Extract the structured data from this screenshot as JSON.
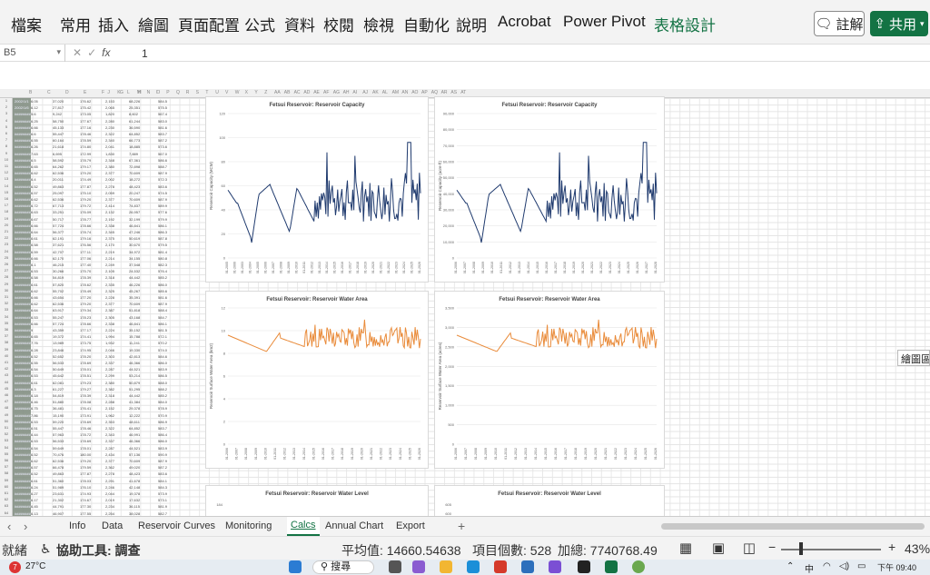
{
  "ribbon": {
    "menu": [
      "檔案",
      "常用",
      "插入",
      "繪圖",
      "頁面配置",
      "公式",
      "資料",
      "校閱",
      "檢視",
      "自動化",
      "說明",
      "Acrobat",
      "Power Pivot",
      "表格設計"
    ],
    "comment_label": "註解",
    "share_label": "共用"
  },
  "formula_bar": {
    "cell_ref": "B5",
    "value": "1"
  },
  "columns": [
    "B",
    "C",
    "D",
    "E",
    "F",
    "G",
    "H",
    "I",
    "J",
    "K",
    "L",
    "M",
    "N",
    "O",
    "P",
    "Q",
    "R",
    "S",
    "T",
    "U",
    "V",
    "W",
    "X",
    "Y",
    "Z",
    "AA",
    "AB",
    "AC",
    "AD",
    "AE",
    "AF",
    "AG",
    "AH",
    "AI",
    "AJ",
    "AK",
    "AL",
    "AM",
    "AN",
    "AO",
    "AP",
    "AQ",
    "AR",
    "AS",
    "AT"
  ],
  "rows_visible": 64,
  "data_rows": [
    [
      "2002/1/1",
      "6.05",
      "37,020",
      "176.62",
      "2,153",
      "68,226",
      "584.5"
    ],
    [
      "2002/1/6",
      "6.12",
      "27,817",
      "175.42",
      "2,065",
      "25,351",
      "575.5"
    ],
    [
      "########",
      "5.6",
      "9,242",
      "173.05",
      "1,820",
      "8,602",
      "567.4"
    ],
    [
      "########",
      "6.25",
      "58,750",
      "177.67",
      "2,280",
      "61,244",
      "583.0"
    ],
    [
      "########",
      "6.66",
      "45,133",
      "177.16",
      "2,230",
      "36,590",
      "581.6"
    ],
    [
      "########",
      "6.6",
      "55,447",
      "178.46",
      "2,322",
      "64,852",
      "583.7"
    ],
    [
      "########",
      "6.55",
      "60,164",
      "178.59",
      "2,340",
      "66,773",
      "587.2"
    ],
    [
      "########",
      "6.26",
      "21,618",
      "174.80",
      "2,041",
      "18,885",
      "573.6"
    ],
    [
      "########",
      "7.63",
      "6,695",
      "172.99",
      "1,830",
      "7,889",
      "567.0"
    ],
    [
      "########",
      "6.5",
      "58,592",
      "178.79",
      "2,348",
      "67,361",
      "586.6"
    ],
    [
      "########",
      "6.65",
      "64,262",
      "179.17",
      "2,380",
      "72,898",
      "588.7"
    ],
    [
      "########",
      "6.62",
      "62,536",
      "179.20",
      "2,377",
      "70,609",
      "587.9"
    ],
    [
      "########",
      "6.4",
      "20,011",
      "174.49",
      "2,002",
      "18,272",
      "572.3"
    ],
    [
      "########",
      "6.52",
      "49,863",
      "177.87",
      "2,278",
      "48,423",
      "583.6"
    ],
    [
      "########",
      "6.57",
      "25,097",
      "175.10",
      "2,059",
      "20,247",
      "574.5"
    ],
    [
      "########",
      "6.62",
      "62,536",
      "179.20",
      "2,377",
      "70,609",
      "587.9"
    ],
    [
      "########",
      "6.72",
      "67,713",
      "179.72",
      "2,414",
      "74,837",
      "589.9"
    ],
    [
      "########",
      "6.63",
      "33,251",
      "176.09",
      "2,132",
      "26,957",
      "577.6"
    ],
    [
      "########",
      "6.67",
      "50,717",
      "178.77",
      "2,192",
      "32,199",
      "579.9"
    ],
    [
      "########",
      "6.66",
      "57,724",
      "178.66",
      "2,338",
      "46,841",
      "586.1"
    ],
    [
      "########",
      "6.64",
      "56,377",
      "178.74",
      "2,345",
      "47,246",
      "586.3"
    ],
    [
      "########",
      "6.61",
      "62,191",
      "179.16",
      "2,375",
      "50,619",
      "587.8"
    ],
    [
      "########",
      "6.58",
      "37,621",
      "176.56",
      "2,170",
      "30,670",
      "579.5"
    ],
    [
      "########",
      "6.59",
      "42,707",
      "177.11",
      "2,219",
      "34,972",
      "581.4"
    ],
    [
      "########",
      "6.66",
      "62,170",
      "177.06",
      "2,214",
      "34,155",
      "580.8"
    ],
    [
      "########",
      "6.1",
      "46,215",
      "177.40",
      "2,249",
      "37,548",
      "582.3"
    ],
    [
      "########",
      "6.53",
      "30,266",
      "175.70",
      "2,105",
      "24,532",
      "576.4"
    ],
    [
      "########",
      "6.58",
      "54,819",
      "178.39",
      "2,318",
      "44,442",
      "585.2"
    ],
    [
      "########",
      "6.61",
      "57,820",
      "178.62",
      "2,335",
      "46,226",
      "586.0"
    ],
    [
      "########",
      "6.62",
      "55,702",
      "178.49",
      "2,325",
      "45,267",
      "585.6"
    ],
    [
      "########",
      "6.66",
      "43,654",
      "177.20",
      "2,228",
      "35,391",
      "581.6"
    ],
    [
      "########",
      "6.62",
      "62,536",
      "179.20",
      "2,377",
      "70,609",
      "587.9"
    ],
    [
      "########",
      "6.64",
      "63,917",
      "179.34",
      "2,387",
      "51,818",
      "588.4"
    ],
    [
      "########",
      "6.53",
      "55,247",
      "178.23",
      "2,305",
      "43,168",
      "584.7"
    ],
    [
      "########",
      "6.66",
      "57,724",
      "178.66",
      "2,338",
      "46,841",
      "586.1"
    ],
    [
      "########",
      "9",
      "43,359",
      "177.17",
      "2,224",
      "35,152",
      "581.5"
    ],
    [
      "########",
      "6.65",
      "19,372",
      "174.41",
      "1,994",
      "15,788",
      "572.1"
    ],
    [
      "########",
      "7.76",
      "13,989",
      "173.75",
      "1,932",
      "11,241",
      "570.2"
    ],
    [
      "########",
      "6.28",
      "23,846",
      "174.95",
      "2,046",
      "19,330",
      "574.0"
    ],
    [
      "########",
      "6.52",
      "52,652",
      "178.20",
      "2,303",
      "42,813",
      "584.6"
    ],
    [
      "########",
      "6.55",
      "56,533",
      "178.69",
      "2,337",
      "46,366",
      "586.0"
    ],
    [
      "########",
      "6.54",
      "50,649",
      "178.01",
      "2,287",
      "44,521",
      "583.9"
    ],
    [
      "########",
      "6.53",
      "45,642",
      "178.51",
      "2,299",
      "53,214",
      "586.5"
    ],
    [
      "########",
      "6.61",
      "62,081",
      "179.23",
      "2,380",
      "50,879",
      "588.0"
    ],
    [
      "########",
      "6.3",
      "61,227",
      "179.27",
      "2,382",
      "51,295",
      "588.2"
    ],
    [
      "########",
      "6.18",
      "54,819",
      "178.39",
      "2,318",
      "44,442",
      "585.2"
    ],
    [
      "########",
      "6.46",
      "51,880",
      "178.08",
      "2,288",
      "41,384",
      "584.0"
    ],
    [
      "########",
      "6.75",
      "36,481",
      "176.41",
      "2,152",
      "29,378",
      "578.9"
    ],
    [
      "########",
      "7.86",
      "15,190",
      "173.91",
      "1,962",
      "12,222",
      "570.9"
    ],
    [
      "########",
      "6.53",
      "59,220",
      "178.69",
      "2,353",
      "48,611",
      "586.9"
    ],
    [
      "########",
      "6.51",
      "55,447",
      "178.46",
      "2,322",
      "64,852",
      "583.7"
    ],
    [
      "########",
      "6.44",
      "57,963",
      "178.72",
      "2,343",
      "46,991",
      "586.4"
    ],
    [
      "########",
      "6.53",
      "56,533",
      "178.69",
      "2,337",
      "46,366",
      "586.0"
    ],
    [
      "########",
      "6.54",
      "59,649",
      "178.01",
      "2,287",
      "44,521",
      "583.9"
    ],
    [
      "########",
      "6.52",
      "70,476",
      "180.00",
      "2,434",
      "57,136",
      "590.9"
    ],
    [
      "########",
      "6.62",
      "62,536",
      "179.20",
      "2,377",
      "70,609",
      "587.9"
    ],
    [
      "########",
      "6.57",
      "66,478",
      "179.59",
      "2,362",
      "49,020",
      "587.2"
    ],
    [
      "########",
      "6.52",
      "49,863",
      "177.87",
      "2,278",
      "48,423",
      "583.6"
    ],
    [
      "########",
      "6.61",
      "51,360",
      "178.03",
      "2,291",
      "41,678",
      "584.1"
    ],
    [
      "########",
      "6.24",
      "51,989",
      "176.10",
      "2,246",
      "42,148",
      "584.3"
    ],
    [
      "########",
      "6.27",
      "23,631",
      "174.93",
      "2,044",
      "19,378",
      "573.9"
    ],
    [
      "########",
      "6.17",
      "21,302",
      "174.67",
      "2,019",
      "17,632",
      "573.1"
    ],
    [
      "########",
      "6.45",
      "44,791",
      "177.30",
      "2,234",
      "36,115",
      "581.9"
    ],
    [
      "########",
      "6.13",
      "46,907",
      "177.55",
      "2,254",
      "38,028",
      "582.7"
    ]
  ],
  "charts": [
    {
      "title": "Fetsui Reservoir: Reservoir Capacity",
      "ylabel": "Reservoir Capacity (MCM)",
      "color": "#1f3a6e",
      "yticks": [
        "0",
        "20",
        "40",
        "60",
        "80",
        "100",
        "120"
      ],
      "xticks": [
        "01-2005",
        "01-2006",
        "01-2003",
        "01-2004",
        "01-2005",
        "01-2006",
        "01-2007",
        "01-2008",
        "01-2009",
        "01-2010",
        "01-2011",
        "01-2012",
        "01-2013",
        "01-2014",
        "01-2015",
        "01-2016",
        "01-2017",
        "01-2018",
        "01-2019",
        "01-2020",
        "01-2021",
        "01-2022",
        "01-2023",
        "01-2024",
        "01-2025",
        "01-2026"
      ]
    },
    {
      "title": "Fetsui Reservoir: Reservoir Capacity",
      "ylabel": "Reservoir Capacity (acre-ft)",
      "color": "#1f3a6e",
      "yticks": [
        "0",
        "10,000",
        "20,000",
        "30,000",
        "40,000",
        "50,000",
        "60,000",
        "70,000",
        "80,000",
        "90,000"
      ],
      "xticks": [
        "01-2006",
        "01-2007",
        "01-2008",
        "01-2009",
        "01-2010",
        "01-2011",
        "01-2012",
        "01-2013",
        "01-2014",
        "01-2015",
        "01-2016",
        "01-2017",
        "01-2018",
        "01-2019",
        "01-2020",
        "01-2021",
        "01-2022",
        "01-2023",
        "01-2024",
        "01-2025",
        "01-2026",
        "01-2027",
        "01-2028"
      ]
    },
    {
      "title": "Fetsui Reservoir: Reservoir Water Area",
      "ylabel": "Reservoir Surface Water Area (km2)",
      "color": "#e98b3a",
      "yticks": [
        "0",
        "2",
        "4",
        "6",
        "8",
        "10",
        "12"
      ],
      "xticks": [
        "01-2006",
        "01-2007",
        "01-2008",
        "01-2009",
        "01-2010",
        "01-2011",
        "01-2012",
        "01-2013",
        "01-2014",
        "01-2015",
        "01-2016",
        "01-2017",
        "01-2018",
        "01-2019",
        "01-2020",
        "01-2021",
        "01-2022",
        "01-2023",
        "01-2024",
        "01-2025",
        "01-2026"
      ]
    },
    {
      "title": "Fetsui Reservoir: Reservoir Water Area",
      "ylabel": "Reservoir Surface Water Area (acres)",
      "color": "#e98b3a",
      "yticks": [
        "0",
        "500",
        "1,000",
        "1,500",
        "2,000",
        "2,500",
        "3,000",
        "3,500"
      ],
      "xticks": [
        "01-2006",
        "01-2007",
        "01-2008",
        "01-2009",
        "01-2010",
        "01-2011",
        "01-2012",
        "01-2013",
        "01-2014",
        "01-2015",
        "01-2016",
        "01-2017",
        "01-2018",
        "01-2019",
        "01-2020",
        "01-2021",
        "01-2022",
        "01-2023",
        "01-2024",
        "01-2025",
        "01-2026"
      ]
    },
    {
      "title": "Fetsui Reservoir: Reservoir Water Level",
      "ylabel": "",
      "color": "#1f3a6e",
      "yticks": [
        "184"
      ],
      "xticks": []
    },
    {
      "title": "Fetsui Reservoir: Reservoir Water Level",
      "ylabel": "",
      "color": "#1f3a6e",
      "yticks": [
        "605",
        "600"
      ],
      "xticks": []
    }
  ],
  "side_label": "繪圖區",
  "tabs": {
    "sheets": [
      "Info",
      "Data",
      "Reservoir Curves",
      "Monitoring",
      "Calcs",
      "Annual Chart",
      "Export"
    ],
    "active": "Calcs",
    "add_label": "+"
  },
  "status": {
    "mode": "就緒",
    "accessibility": "協助工具: 調查",
    "average": "平均值: 14660.54638",
    "count": "項目個數: 528",
    "sum": "加總: 7740768.49",
    "zoom_minus": "−",
    "zoom_plus": "+",
    "zoom": "43%"
  },
  "taskbar": {
    "temperature": "27°C",
    "notification_count": "7",
    "search_label": "搜尋",
    "clock": "下午 09:40"
  }
}
